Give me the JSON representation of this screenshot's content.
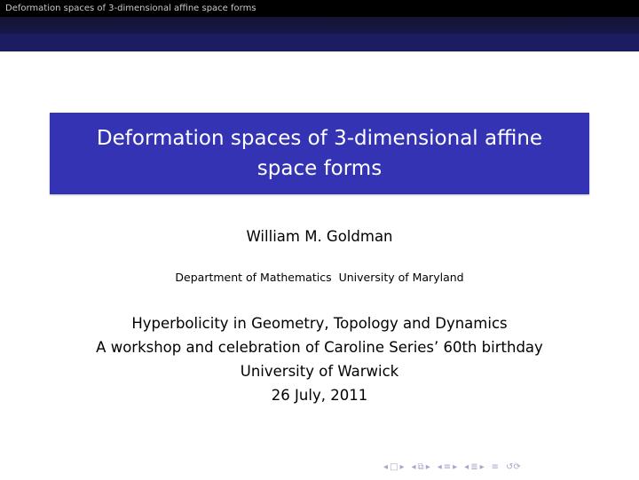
{
  "headline": {
    "short_title": "Deformation spaces of 3-dimensional affine space forms"
  },
  "title": {
    "line1": "Deformation spaces of 3-dimensional affine",
    "line2": "space forms"
  },
  "author": "William M. Goldman",
  "institute": {
    "department": "Department of Mathematics",
    "university": "University of Maryland"
  },
  "event": {
    "name": "Hyperbolicity in Geometry, Topology and Dynamics",
    "subtitle": "A workshop and celebration of Caroline Series’ 60th birthday",
    "venue": "University of Warwick",
    "date": "26 July, 2011"
  },
  "colors": {
    "headline_bg": "#000000",
    "band_dark": "#17174a",
    "band_mid": "#1c1c63",
    "title_box": "#3333b3",
    "nav_symbols": "#a7a7c7"
  },
  "navigation": {
    "icons": [
      "slide-nav-icon",
      "frame-nav-icon",
      "subsection-nav-icon",
      "section-nav-icon",
      "align-icon",
      "search-icon"
    ]
  }
}
